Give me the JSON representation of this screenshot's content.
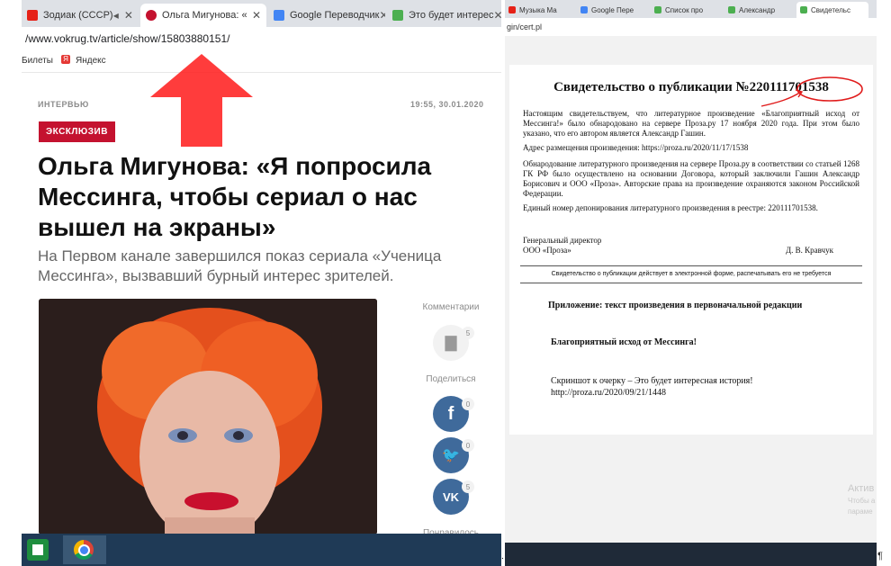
{
  "left": {
    "tabs": [
      {
        "label": "Зодиак (СССР)",
        "icon": "youtube-icon",
        "color": "#e62117"
      },
      {
        "label": "Ольга Мигунова: «",
        "icon": "tv-icon",
        "color": "#c4122f"
      },
      {
        "label": "Google Переводчик",
        "icon": "google-translate-icon",
        "color": "#4285f4"
      },
      {
        "label": "Это будет интерес",
        "icon": "proza-icon",
        "color": "#4caf50"
      }
    ],
    "url": "/www.vokrug.tv/article/show/15803880151/",
    "bookmarks": [
      "Билеты",
      "Яндекс"
    ],
    "rubric": "ИНТЕРВЬЮ",
    "datetime": "19:55, 30.01.2020",
    "badge": "ЭКСКЛЮЗИВ",
    "headline": "Ольга Мигунова: «Я попросила Мессинга, чтобы сериал о нас вышел на экраны»",
    "lead": "На Первом канале завершился показ сериала «Ученица Мессинга», вызвавший бурный интерес зрителей.",
    "side": {
      "comments_label": "Комментарии",
      "comments_count": "5",
      "share_label": "Поделиться",
      "facebook_count": "0",
      "twitter_count": "0",
      "vk_count": "5",
      "liked_label": "Понравилось"
    }
  },
  "right": {
    "tabs": [
      {
        "label": "Музыка Ма",
        "color": "#e62117"
      },
      {
        "label": "Google Пере",
        "color": "#4285f4"
      },
      {
        "label": "Список про",
        "color": "#4caf50"
      },
      {
        "label": "Александр",
        "color": "#4caf50"
      },
      {
        "label": "Свидетельс",
        "color": "#4caf50"
      }
    ],
    "url": "gin/cert.pl",
    "cert": {
      "title": "Свидетельство о публикации №220111701538",
      "p1": "Настоящим свидетельствуем, что литературное произведение «Благоприятный исход от Мессинга!» было обнародовано на сервере Проза.ру 17 ноября 2020 года. При этом было указано, что его автором является Александр Гашин.",
      "address": "Адрес размещения произведения: https://proza.ru/2020/11/17/1538",
      "p2": "Обнародование литературного произведения на сервере Проза.ру в соответствии со статьей 1268 ГК РФ было осуществлено на основании Договора, который заключили Гашин Александр Борисович и ООО «Проза». Авторские права на произведение охраняются законом Российской Федерации.",
      "deposit": "Единый номер депонирования литературного произведения в реестре: 220111701538.",
      "director_title": "Генеральный директор",
      "director_org": "ООО «Проза»",
      "director_name": "Д. В. Кравчук",
      "notice": "Свидетельство о публикации действует в электронной форме, распечатывать его не требуется",
      "appendix": "Приложение: текст произведения в первоначальной редакции",
      "work_title": "Благоприятный исход от Мессинга!",
      "excerpt1": "Скриншот к очерку – Это будет интересная история!",
      "excerpt2": "http://proza.ru/2020/09/21/1448"
    },
    "activate": [
      "Актив",
      "Чтобы а",
      "параме"
    ]
  },
  "separator_dot": ".",
  "pilcrow": "¶"
}
